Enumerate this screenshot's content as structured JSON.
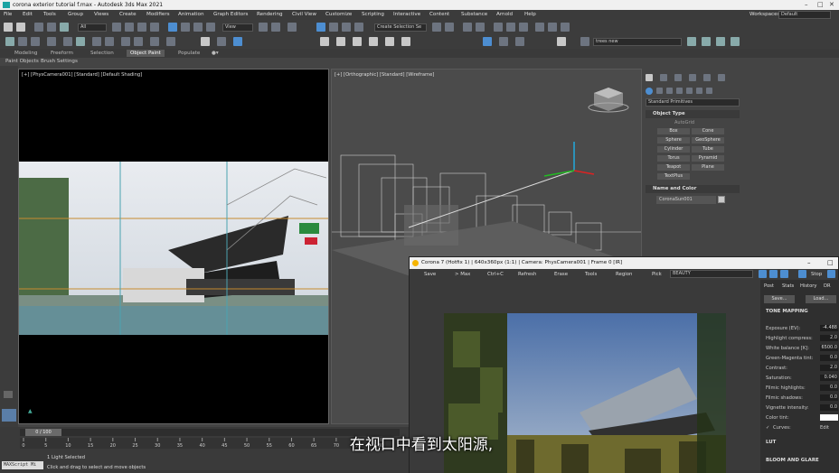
{
  "window": {
    "title": "corona exterior tutorial f.max - Autodesk 3ds Max 2021"
  },
  "menu": [
    "File",
    "Edit",
    "Tools",
    "Group",
    "Views",
    "Create",
    "Modifiers",
    "Animation",
    "Graph Editors",
    "Rendering",
    "Civil View",
    "Customize",
    "Scripting",
    "Interactive",
    "Content",
    "Substance",
    "Arnold",
    "Help"
  ],
  "workspaces": {
    "label": "Workspaces:",
    "value": "Default"
  },
  "toolbar": {
    "filter": "All",
    "view": "View",
    "selection_set": "Create Selection Se",
    "layer": "trees new"
  },
  "ribbon": {
    "tabs": [
      "Modeling",
      "Freeform",
      "Selection",
      "Object Paint",
      "Populate"
    ],
    "active": "Object Paint",
    "sub": [
      "Paint Objects",
      "Brush Settings"
    ]
  },
  "viewports": {
    "left_label": "[+] [PhysCamera001] [Standard] [Default Shading]",
    "right_label": "[+] [Orthographic] [Standard] [Wireframe]"
  },
  "command_panel": {
    "category": "Standard Primitives",
    "object_type_header": "Object Type",
    "autogrid": "AutoGrid",
    "buttons": [
      "Box",
      "Cone",
      "Sphere",
      "GeoSphere",
      "Cylinder",
      "Tube",
      "Torus",
      "Pyramid",
      "Teapot",
      "Plane",
      "TextPlus"
    ],
    "name_color_header": "Name and Color",
    "name_value": "CoronaSun001",
    "swatch_color": "#c8c8c8"
  },
  "vfb": {
    "title": "Corona 7 (Hotfix 1) | 640x360px (1:1) | Camera: PhysCamera001 | Frame 0 [IR]",
    "toolbar": [
      "Save",
      "> Max",
      "Ctrl+C",
      "Refresh",
      "Erase",
      "Tools",
      "Region",
      "Pick"
    ],
    "channel": "BEAUTY",
    "stop": "Stop",
    "tabs": [
      "Post",
      "Stats",
      "History",
      "DR"
    ],
    "save_btn": "Save...",
    "load_btn": "Load...",
    "tone_mapping": "TONE MAPPING",
    "params": [
      {
        "label": "Exposure (EV):",
        "value": "-4.488"
      },
      {
        "label": "Highlight compress:",
        "value": "2.0"
      },
      {
        "label": "White balance [K]:",
        "value": "6500.0"
      },
      {
        "label": "Green-Magenta tint:",
        "value": "0.0"
      },
      {
        "label": "Contrast:",
        "value": "2.0"
      },
      {
        "label": "Saturation:",
        "value": "0.040"
      },
      {
        "label": "Filmic highlights:",
        "value": "0.0"
      },
      {
        "label": "Filmic shadows:",
        "value": "0.0"
      },
      {
        "label": "Vignette intensity:",
        "value": "0.0"
      },
      {
        "label": "Color tint:",
        "value": ""
      }
    ],
    "curves_label": "Curves:",
    "curves_edit": "Edit",
    "lut": "LUT",
    "bloom": "BLOOM AND GLARE"
  },
  "timeline": {
    "frame": "0 / 100",
    "ticks": [
      "0",
      "5",
      "10",
      "15",
      "20",
      "25",
      "30",
      "35",
      "40",
      "45",
      "50",
      "55",
      "60",
      "65",
      "70",
      "75",
      "80"
    ]
  },
  "status": {
    "script": "MAXScript Mi",
    "line1": "1 Light Selected",
    "line2": "Click and drag to select and move objects"
  },
  "subtitle": "在视口中看到太阳源,"
}
